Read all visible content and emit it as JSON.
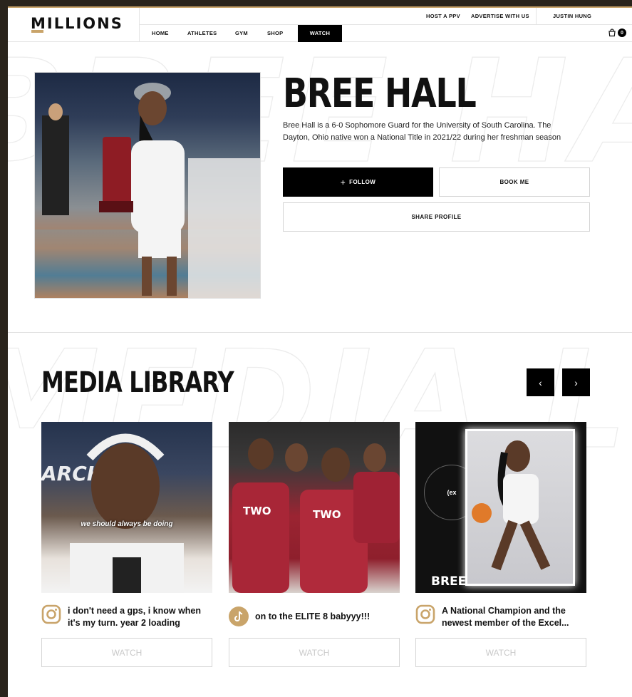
{
  "header": {
    "logo": "MILLIONS",
    "top_links": [
      "HOST A PPV",
      "ADVERTISE WITH US",
      "JUSTIN HUNG"
    ],
    "main_nav": [
      "HOME",
      "ATHLETES",
      "GYM",
      "SHOP",
      "WATCH"
    ],
    "active_nav": "WATCH",
    "cart_count": "0"
  },
  "athlete": {
    "name": "BREE HALL",
    "bio": "Bree Hall is a 6-0 Sophomore Guard for the University of South Carolina. The Dayton, Ohio native won a National Title in 2021/22 during her freshman season",
    "follow_label": "FOLLOW",
    "book_label": "BOOK ME",
    "share_label": "SHARE PROFILE"
  },
  "media": {
    "title": "MEDIA LIBRARY",
    "prev": "‹",
    "next": "›",
    "items": [
      {
        "platform": "instagram-icon",
        "caption": "i don't need a gps, i know when it's my turn. year 2 loading",
        "watch": "WATCH",
        "overlay": "we should always be doing"
      },
      {
        "platform": "tiktok-icon",
        "caption": "on to the ELITE 8 babyyy!!!",
        "watch": "WATCH",
        "overlay": ""
      },
      {
        "platform": "instagram-icon",
        "caption": "A National Champion and the newest member of the Excel...",
        "watch": "WATCH",
        "overlay": "BREE"
      }
    ]
  },
  "colors": {
    "accent": "#c9a46a",
    "primary": "#000000",
    "watermark": "#ececec"
  }
}
